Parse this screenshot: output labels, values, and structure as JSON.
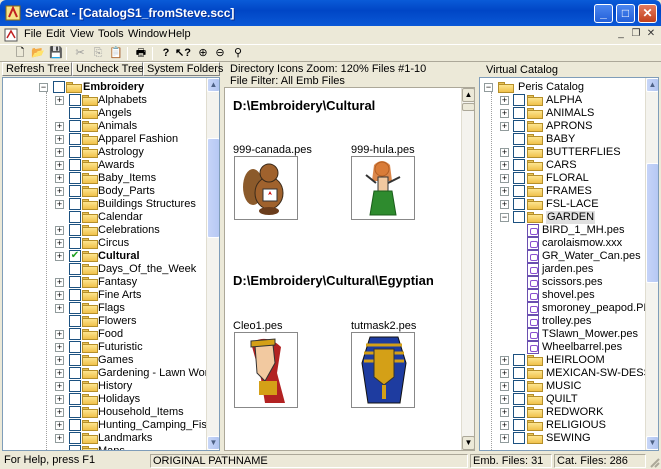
{
  "window": {
    "title": "SewCat - [CatalogS1_fromSteve.scc]"
  },
  "menu": [
    "File",
    "Edit",
    "View",
    "Tools",
    "Window",
    "Help"
  ],
  "toolbar": {
    "icons": [
      "new-icon",
      "open-icon",
      "save-icon",
      "cut-icon",
      "copy-icon",
      "paste-icon",
      "print-icon",
      "help-icon",
      "context-help-icon",
      "zoom-in-icon",
      "zoom-out-icon",
      "find-icon"
    ]
  },
  "left": {
    "buttons": [
      "Refresh Tree",
      "Uncheck Tree",
      "System Folders"
    ],
    "root": "Embroidery",
    "folders": [
      "Alphabets",
      "Angels",
      "Animals",
      "Apparel Fashion",
      "Astrology",
      "Awards",
      "Baby_Items",
      "Body_Parts",
      "Buildings Structures",
      "Calendar",
      "Celebrations",
      "Circus",
      "Cultural",
      "Days_Of_the_Week",
      "Fantasy",
      "Fine Arts",
      "Flags",
      "Flowers",
      "Food",
      "Futuristic",
      "Games",
      "Gardening - Lawn Work",
      "History",
      "Holidays",
      "Household_Items",
      "Hunting_Camping_Fishing",
      "Landmarks",
      "Maps"
    ],
    "expandable": [
      0,
      2,
      3,
      4,
      5,
      6,
      7,
      8,
      10,
      11,
      12,
      14,
      15,
      16,
      18,
      19,
      20,
      21,
      22,
      23,
      24,
      25,
      26
    ],
    "checked_index": 12
  },
  "middle": {
    "header_line1": "Directory Icons Zoom: 120%   Files #1-10",
    "header_line2": "File Filter: All Emb Files",
    "sections": [
      {
        "path": "D:\\Embroidery\\Cultural",
        "files": [
          "999-canada.pes",
          "999-hula.pes"
        ]
      },
      {
        "path": "D:\\Embroidery\\Cultural\\Egyptian",
        "files": [
          "Cleo1.pes",
          "tutmask2.pes"
        ]
      }
    ]
  },
  "right": {
    "header": "Virtual Catalog",
    "root": "Peris Catalog",
    "items_before": [
      "ALPHA",
      "ANIMALS",
      "APRONS",
      "BABY",
      "BUTTERFLIES",
      "CARS",
      "FLORAL",
      "FRAMES",
      "FSL-LACE"
    ],
    "expanded": "GARDEN",
    "garden_files": [
      "BIRD_1_MH.pes",
      "carolaismow.xxx",
      "GR_Water_Can.pes",
      "jarden.pes",
      "scissors.pes",
      "shovel.pes",
      "smoroney_peapod.PES",
      "trolley.pes",
      "TSlawn_Mower.pes",
      "Wheelbarrel.pes"
    ],
    "items_after": [
      "HEIRLOOM",
      "MEXICAN-SW-DESSERT",
      "MUSIC",
      "QUILT",
      "REDWORK",
      "RELIGIOUS",
      "SEWING"
    ]
  },
  "status": {
    "help": "For Help, press F1",
    "path": "ORIGINAL PATHNAME",
    "emb_files": "Emb. Files: 31",
    "cat_files": "Cat. Files: 286"
  },
  "colors": {
    "titlebar": "#0a5bd8",
    "folder": "#f0c24b",
    "selection": "#316ac5"
  }
}
